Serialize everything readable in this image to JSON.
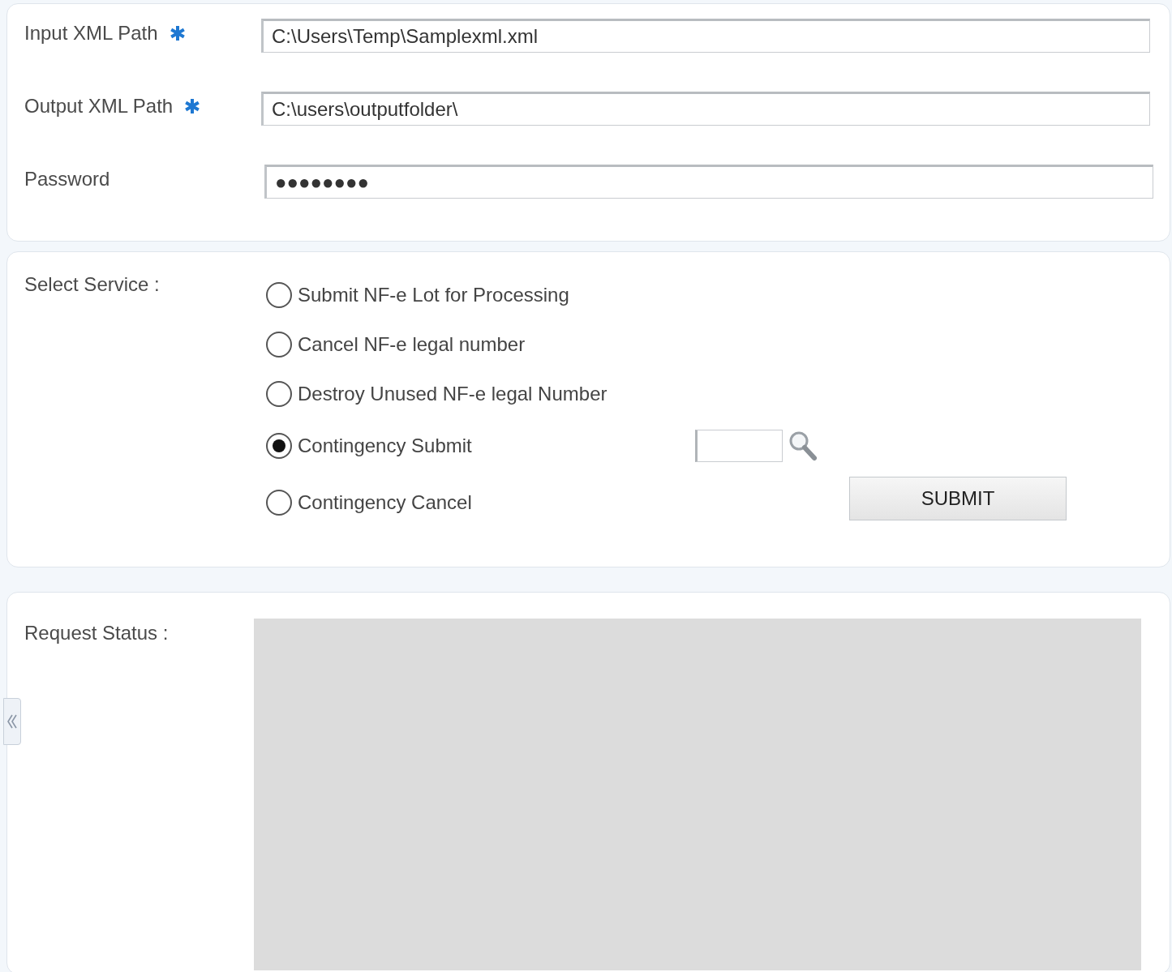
{
  "paths": [
    {
      "label": "Input XML Path",
      "required": true,
      "value": "C:\\Users\\Temp\\Samplexml.xml"
    },
    {
      "label": "Output XML Path",
      "required": true,
      "value": "C:\\users\\outputfolder\\"
    },
    {
      "label": "Password",
      "required": false,
      "value": "●●●●●●●●"
    }
  ],
  "service": {
    "label": "Select Service :",
    "options": [
      {
        "label": "Submit NF-e Lot for Processing",
        "selected": false
      },
      {
        "label": "Cancel NF-e legal number",
        "selected": false
      },
      {
        "label": "Destroy Unused NF-e legal Number",
        "selected": false
      },
      {
        "label": "Contingency Submit",
        "selected": true
      },
      {
        "label": "Contingency Cancel",
        "selected": false
      }
    ],
    "submit_button": "SUBMIT"
  },
  "status": {
    "label": "Request Status :"
  }
}
